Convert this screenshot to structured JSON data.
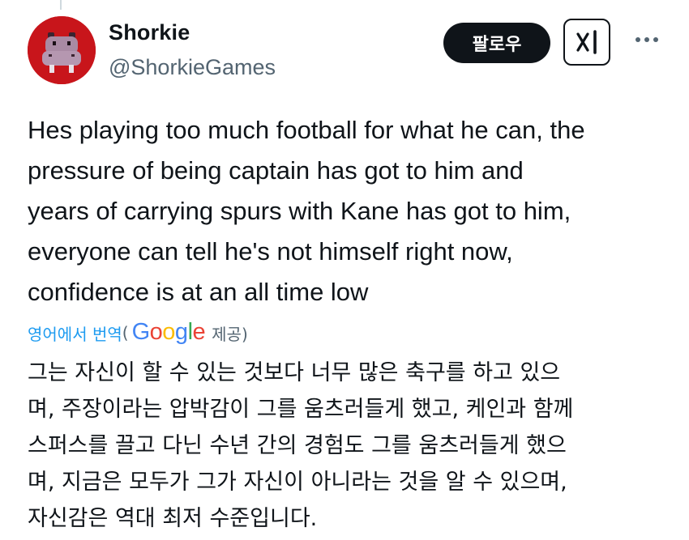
{
  "tweet": {
    "author": {
      "display_name": "Shorkie",
      "handle": "@ShorkieGames",
      "avatar_icon": "hippo-avatar-icon"
    },
    "follow_label": "팔로우",
    "grok_icon": "grok-icon",
    "more_icon": "more-icon",
    "text_lines": [
      "Hes playing too much football for what he can, the",
      "pressure of being captain has got to him and",
      "years of carrying spurs with Kane has got to him,",
      "everyone can tell he's not himself right now,",
      "confidence is at an all time low"
    ],
    "translation": {
      "link_label": "영어에서 번역",
      "open_paren": "(",
      "provider_prefix": "",
      "provider_suffix": "제공)",
      "google_letters": [
        "G",
        "o",
        "o",
        "g",
        "l",
        "e"
      ],
      "lines": [
        "그는 자신이 할 수 있는 것보다 너무 많은 축구를 하고 있으",
        "며, 주장이라는 압박감이 그를 움츠러들게 했고, 케인과 함께",
        "스퍼스를 끌고 다닌 수년 간의 경험도 그를 움츠러들게 했으",
        "며, 지금은 모두가 그가 자신이 아니라는 것을 알 수 있으며,",
        "자신감은 역대 최저 수준입니다."
      ]
    }
  },
  "colors": {
    "text_primary": "#0f1419",
    "text_secondary": "#536471",
    "link_blue": "#1d9bf0",
    "avatar_bg": "#c8151b",
    "google": [
      "#4285f4",
      "#ea4335",
      "#fbbc05",
      "#4285f4",
      "#34a853",
      "#ea4335"
    ]
  }
}
